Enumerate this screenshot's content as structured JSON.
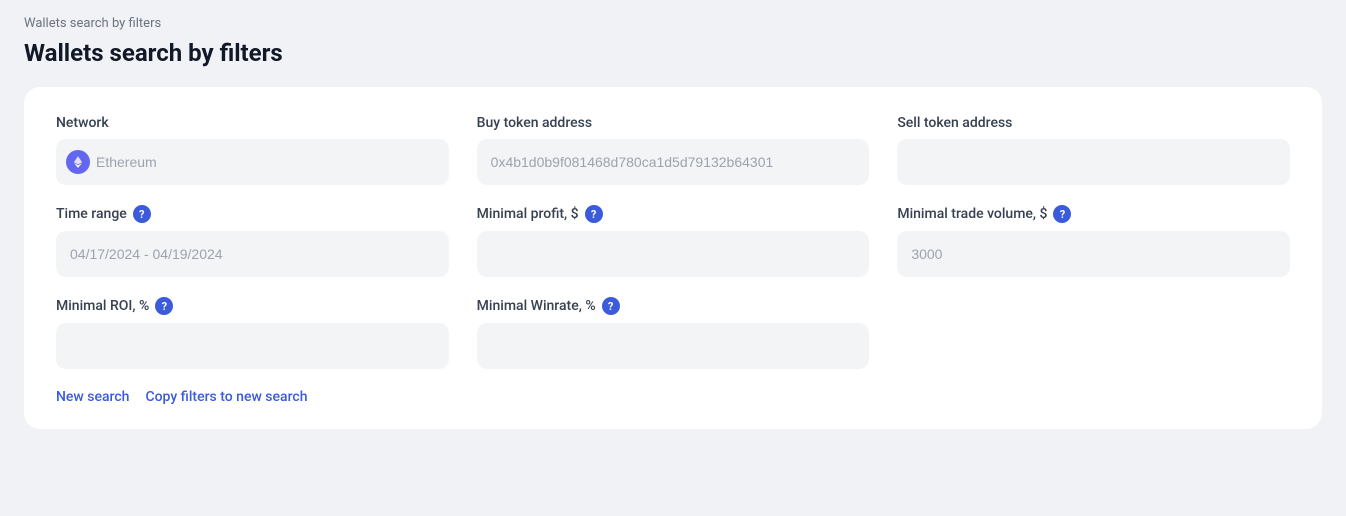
{
  "breadcrumb": {
    "text": "Wallets search by filters"
  },
  "page": {
    "title": "Wallets search by filters"
  },
  "filters": {
    "network": {
      "label": "Network",
      "placeholder": "Ethereum",
      "value": ""
    },
    "buy_token": {
      "label": "Buy token address",
      "placeholder": "0x4b1d0b9f081468d780ca1d5d79132b64301",
      "value": ""
    },
    "sell_token": {
      "label": "Sell token address",
      "placeholder": "",
      "value": ""
    },
    "time_range": {
      "label": "Time range",
      "help": "?",
      "placeholder": "04/17/2024 - 04/19/2024",
      "value": ""
    },
    "minimal_profit": {
      "label": "Minimal profit, $",
      "help": "?",
      "placeholder": "",
      "value": ""
    },
    "minimal_trade_volume": {
      "label": "Minimal trade volume, $",
      "help": "?",
      "placeholder": "3000",
      "value": ""
    },
    "minimal_roi": {
      "label": "Minimal ROI, %",
      "help": "?",
      "placeholder": "",
      "value": ""
    },
    "minimal_winrate": {
      "label": "Minimal Winrate, %",
      "help": "?",
      "placeholder": "",
      "value": ""
    }
  },
  "actions": {
    "new_search": "New search",
    "copy_filters": "Copy filters to new search"
  }
}
